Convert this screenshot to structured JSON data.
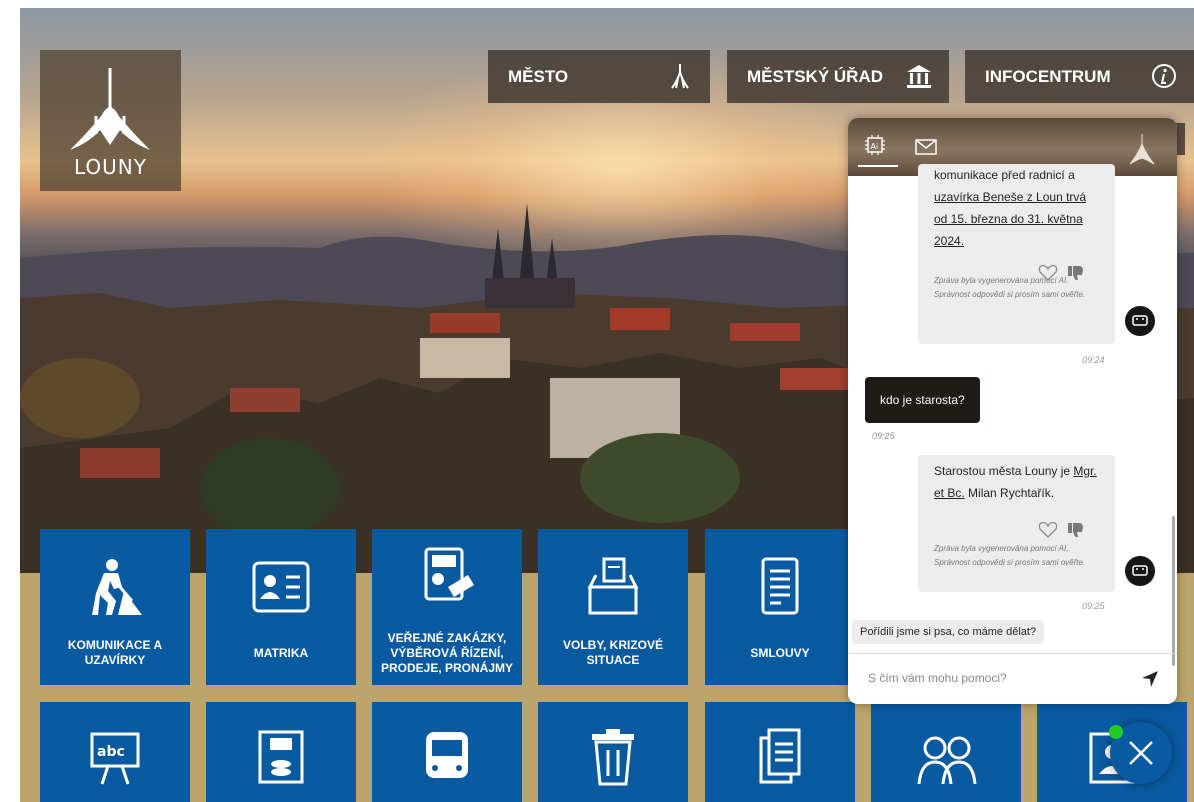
{
  "site": {
    "logo_text": "LOUNY"
  },
  "topnav": [
    {
      "label": "MĚSTO",
      "icon": "towers-icon"
    },
    {
      "label": "MĚSTSKÝ ÚŘAD",
      "icon": "building-icon"
    },
    {
      "label": "INFOCENTRUM",
      "icon": "info-icon"
    }
  ],
  "tiles_row1": [
    {
      "label": "KOMUNIKACE A UZAVÍRKY",
      "icon": "roadwork-icon"
    },
    {
      "label": "MATRIKA",
      "icon": "id-card-icon"
    },
    {
      "label": "VEŘEJNÉ ZAKÁZKY, VÝBĚROVÁ ŘÍZENÍ, PRODEJE, PRONÁJMY",
      "icon": "report-money-icon"
    },
    {
      "label": "VOLBY, KRIZOVÉ SITUACE",
      "icon": "ballot-box-icon"
    },
    {
      "label": "SMLOUVY",
      "icon": "contract-icon"
    }
  ],
  "tiles_row2": [
    {
      "icon": "school-board-icon"
    },
    {
      "icon": "finance-building-icon"
    },
    {
      "icon": "bus-icon"
    },
    {
      "icon": "trash-bin-icon"
    },
    {
      "icon": "documents-icon"
    },
    {
      "icon": "seniors-icon"
    },
    {
      "icon": "person-frame-icon"
    }
  ],
  "chat": {
    "tabs": [
      {
        "name": "ai-chat",
        "icon": "ai-chip-icon",
        "active": true
      },
      {
        "name": "message",
        "icon": "envelope-icon",
        "active": false
      }
    ],
    "messages": {
      "bot1": {
        "text_before": "komunikace před radnicí a",
        "link": "uzavírka Beneše z Loun trvá od 15. března do 31. května 2024.",
        "note": "Zpráva byla vygenerována pomocí AI. Správnost odpovědi si prosím sami ověřte.",
        "time": "09:24"
      },
      "user1": {
        "text": "kdo je starosta?",
        "time": "09:25"
      },
      "bot2": {
        "text_before": "Starostou města Louny je",
        "link": "Mgr. et Bc.",
        "text_after": "Milan Rychtařík.",
        "note": "Zpráva byla vygenerována pomocí AI. Správnost odpovědi si prosím sami ověřte.",
        "time": "09:25"
      }
    },
    "suggestion": "Pořídili jsme si psa, co máme dělat?",
    "input_placeholder": "S čím vám mohu pomoci?"
  },
  "colors": {
    "tile_blue": "#0a5aa1",
    "gold": "#bba56c",
    "online": "#22cc22"
  }
}
